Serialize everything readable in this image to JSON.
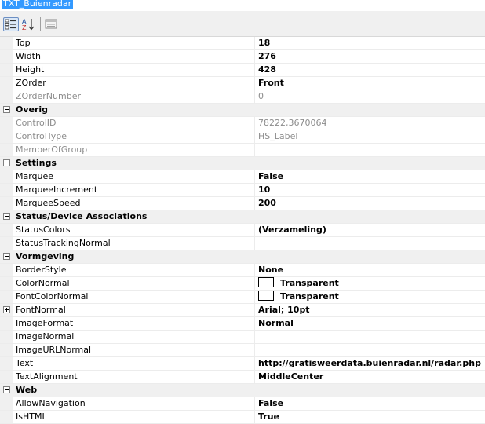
{
  "window": {
    "title": "TXT_Buienradar"
  },
  "toolbar": {
    "categorized": {
      "icon": "categorized-icon"
    },
    "alphabetical": {
      "icon": "alphabetical-icon"
    },
    "property_pages": {
      "icon": "property-pages-icon"
    }
  },
  "rows": [
    {
      "kind": "prop",
      "name": "Top",
      "value": "18",
      "bold": true
    },
    {
      "kind": "prop",
      "name": "Width",
      "value": "276",
      "bold": true
    },
    {
      "kind": "prop",
      "name": "Height",
      "value": "428",
      "bold": true
    },
    {
      "kind": "prop",
      "name": "ZOrder",
      "value": "Front",
      "bold": true
    },
    {
      "kind": "prop",
      "name": "ZOrderNumber",
      "value": "0",
      "disabled": true
    },
    {
      "kind": "cat",
      "name": "Overig"
    },
    {
      "kind": "prop",
      "name": "ControlID",
      "value": "78222,3670064",
      "disabled": true
    },
    {
      "kind": "prop",
      "name": "ControlType",
      "value": "HS_Label",
      "disabled": true
    },
    {
      "kind": "prop",
      "name": "MemberOfGroup",
      "value": "",
      "disabled": true
    },
    {
      "kind": "cat",
      "name": "Settings"
    },
    {
      "kind": "prop",
      "name": "Marquee",
      "value": "False",
      "bold": true
    },
    {
      "kind": "prop",
      "name": "MarqueeIncrement",
      "value": "10",
      "bold": true
    },
    {
      "kind": "prop",
      "name": "MarqueeSpeed",
      "value": "200",
      "bold": true
    },
    {
      "kind": "cat",
      "name": "Status/Device Associations"
    },
    {
      "kind": "prop",
      "name": "StatusColors",
      "value": "(Verzameling)",
      "bold": true
    },
    {
      "kind": "prop",
      "name": "StatusTrackingNormal",
      "value": ""
    },
    {
      "kind": "cat",
      "name": "Vormgeving"
    },
    {
      "kind": "prop",
      "name": "BorderStyle",
      "value": "None",
      "bold": true
    },
    {
      "kind": "prop",
      "name": "ColorNormal",
      "value": "Transparent",
      "bold": true,
      "swatch": true
    },
    {
      "kind": "prop",
      "name": "FontColorNormal",
      "value": "Transparent",
      "bold": true,
      "swatch": true
    },
    {
      "kind": "prop",
      "name": "FontNormal",
      "value": "Arial; 10pt",
      "bold": true,
      "expander": "plus"
    },
    {
      "kind": "prop",
      "name": "ImageFormat",
      "value": "Normal",
      "bold": true
    },
    {
      "kind": "prop",
      "name": "ImageNormal",
      "value": ""
    },
    {
      "kind": "prop",
      "name": "ImageURLNormal",
      "value": ""
    },
    {
      "kind": "prop",
      "name": "Text",
      "value": "http://gratisweerdata.buienradar.nl/radar.php",
      "bold": true
    },
    {
      "kind": "prop",
      "name": "TextAlignment",
      "value": "MiddleCenter",
      "bold": true
    },
    {
      "kind": "cat",
      "name": "Web"
    },
    {
      "kind": "prop",
      "name": "AllowNavigation",
      "value": "False",
      "bold": true
    },
    {
      "kind": "prop",
      "name": "IsHTML",
      "value": "True",
      "bold": true
    }
  ]
}
